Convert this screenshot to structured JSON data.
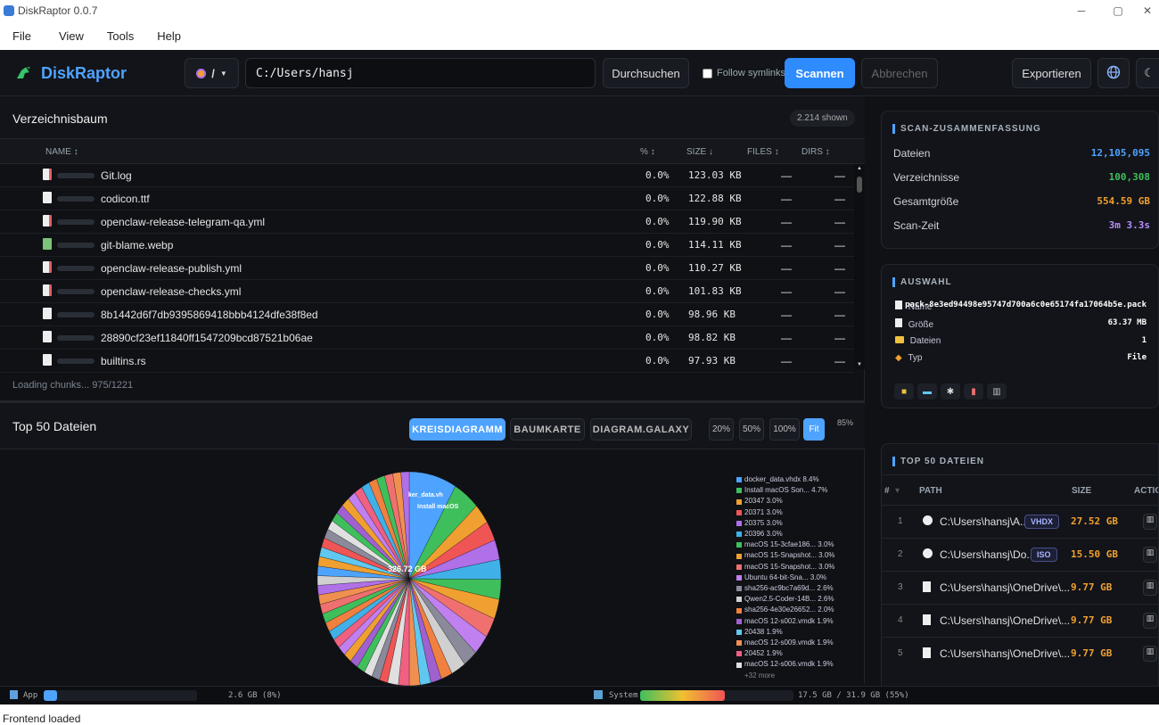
{
  "window": {
    "title": "DiskRaptor 0.0.7",
    "controls": [
      "─",
      "▢",
      "✕"
    ]
  },
  "menu": [
    "File",
    "View",
    "Tools",
    "Help"
  ],
  "toolbar": {
    "logo": "DiskRaptor",
    "drive": "/",
    "path": "C:/Users/hansj",
    "browse": "Durchsuchen",
    "follow_symlinks": "Follow symlinks",
    "scan": "Scannen",
    "cancel": "Abbrechen",
    "export": "Exportieren"
  },
  "tree": {
    "title": "Verzeichnisbaum",
    "shown": "2.214 shown",
    "columns": {
      "name": "NAME ↕",
      "pct": "% ↕",
      "size": "SIZE ↓",
      "files": "FILES ↕",
      "dirs": "DIRS ↕"
    },
    "rows": [
      {
        "name": "Git.log",
        "pct": "0.0%",
        "size": "123.03 KB",
        "files": "—",
        "dirs": "—",
        "icon": "red"
      },
      {
        "name": "codicon.ttf",
        "pct": "0.0%",
        "size": "122.88 KB",
        "files": "—",
        "dirs": "—",
        "icon": "plain"
      },
      {
        "name": "openclaw-release-telegram-qa.yml",
        "pct": "0.0%",
        "size": "119.90 KB",
        "files": "—",
        "dirs": "—",
        "icon": "red"
      },
      {
        "name": "git-blame.webp",
        "pct": "0.0%",
        "size": "114.11 KB",
        "files": "—",
        "dirs": "—",
        "icon": "green"
      },
      {
        "name": "openclaw-release-publish.yml",
        "pct": "0.0%",
        "size": "110.27 KB",
        "files": "—",
        "dirs": "—",
        "icon": "red"
      },
      {
        "name": "openclaw-release-checks.yml",
        "pct": "0.0%",
        "size": "101.83 KB",
        "files": "—",
        "dirs": "—",
        "icon": "red"
      },
      {
        "name": "8b1442d6f7db9395869418bbb4124dfe38f8ed",
        "pct": "0.0%",
        "size": "98.96 KB",
        "files": "—",
        "dirs": "—",
        "icon": "plain"
      },
      {
        "name": "28890cf23ef11840ff1547209bcd87521b06ae",
        "pct": "0.0%",
        "size": "98.82 KB",
        "files": "—",
        "dirs": "—",
        "icon": "plain"
      },
      {
        "name": "builtins.rs",
        "pct": "0.0%",
        "size": "97.93 KB",
        "files": "—",
        "dirs": "—",
        "icon": "plain"
      }
    ],
    "loading": "Loading chunks... 975/1221"
  },
  "chart_panel": {
    "title": "Top 50 Dateien",
    "tabs": [
      "KREISDIAGRAMM",
      "BAUMKARTE",
      "DIAGRAM.GALAXY"
    ],
    "zooms": [
      "20%",
      "50%",
      "100%",
      "Fit"
    ],
    "zoom_level": "85%",
    "center_label": "326.72 GB",
    "slice_labels": [
      "ker_data.vh",
      "Install macOS"
    ],
    "more": "+32 more"
  },
  "chart_data": {
    "type": "pie",
    "total": "326.72 GB",
    "legend": [
      {
        "label": "docker_data.vhdx 8.4%",
        "value": 8.4,
        "color": "#4ea3ff"
      },
      {
        "label": "Install macOS Son... 4.7%",
        "value": 4.7,
        "color": "#3fbf5c"
      },
      {
        "label": "20347 3.0%",
        "value": 3.0,
        "color": "#f0a030"
      },
      {
        "label": "20371 3.0%",
        "value": 3.0,
        "color": "#f05555"
      },
      {
        "label": "20375 3.0%",
        "value": 3.0,
        "color": "#b070e8"
      },
      {
        "label": "20396 3.0%",
        "value": 3.0,
        "color": "#40b0e8"
      },
      {
        "label": "macOS 15-3cfae186... 3.0%",
        "value": 3.0,
        "color": "#3fbf5c"
      },
      {
        "label": "macOS 15-Snapshot... 3.0%",
        "value": 3.0,
        "color": "#f0a030"
      },
      {
        "label": "macOS 15-Snapshot... 3.0%",
        "value": 3.0,
        "color": "#f07070"
      },
      {
        "label": "Ubuntu 64-bit-Sna... 3.0%",
        "value": 3.0,
        "color": "#c080f0"
      },
      {
        "label": "sha256-ac9bc7a69d... 2.6%",
        "value": 2.6,
        "color": "#8a8a9a"
      },
      {
        "label": "Qwen2.5-Coder-14B... 2.6%",
        "value": 2.6,
        "color": "#d0d0d0"
      },
      {
        "label": "sha256-4e30e26652... 2.0%",
        "value": 2.0,
        "color": "#f08040"
      },
      {
        "label": "macOS 12-s002.vmdk 1.9%",
        "value": 1.9,
        "color": "#a060d0"
      },
      {
        "label": "20438 1.9%",
        "value": 1.9,
        "color": "#60c8f0"
      },
      {
        "label": "macOS 12-s009.vmdk 1.9%",
        "value": 1.9,
        "color": "#f09050"
      },
      {
        "label": "20452 1.9%",
        "value": 1.9,
        "color": "#f06080"
      },
      {
        "label": "macOS 12-s006.vmdk 1.9%",
        "value": 1.9,
        "color": "#e0e0e0"
      }
    ]
  },
  "summary": {
    "title": "SCAN-ZUSAMMENFASSUNG",
    "items": [
      {
        "label": "Dateien",
        "value": "12,105,095",
        "color": "#4ea3ff"
      },
      {
        "label": "Verzeichnisse",
        "value": "100,308",
        "color": "#3fbf5c"
      },
      {
        "label": "Gesamtgröße",
        "value": "554.59 GB",
        "color": "#f0a030"
      },
      {
        "label": "Scan-Zeit",
        "value": "3m 3.3s",
        "color": "#b98cff"
      }
    ]
  },
  "selection": {
    "title": "AUSWAHL",
    "name_label": "Name",
    "name_value": "pack-8e3ed94498e95747d700a6c0e65174fa17064b5e.pack",
    "size_label": "Größe",
    "size_value": "63.37 MB",
    "files_label": "Dateien",
    "files_value": "1",
    "type_label": "Typ",
    "type_value": "File"
  },
  "top50": {
    "title": "TOP 50 DATEIEN",
    "columns": {
      "num": "#",
      "path": "PATH",
      "size": "SIZE",
      "action": "ACTIO"
    },
    "rows": [
      {
        "num": "1",
        "path": "C:\\Users\\hansj\\A...",
        "tag": "VHDX",
        "size": "27.52 GB"
      },
      {
        "num": "2",
        "path": "C:\\Users\\hansj\\Do...",
        "tag": "ISO",
        "size": "15.50 GB"
      },
      {
        "num": "3",
        "path": "C:\\Users\\hansj\\OneDrive\\...",
        "tag": "",
        "size": "9.77 GB"
      },
      {
        "num": "4",
        "path": "C:\\Users\\hansj\\OneDrive\\...",
        "tag": "",
        "size": "9.77 GB"
      },
      {
        "num": "5",
        "path": "C:\\Users\\hansj\\OneDrive\\...",
        "tag": "",
        "size": "9.77 GB"
      }
    ]
  },
  "statusbar": {
    "app_label": "App",
    "app_mem": "2.6 GB (8%)",
    "system_label": "System",
    "system_mem": "17.5 GB / 31.9 GB (55%)"
  },
  "footer": "Frontend loaded"
}
